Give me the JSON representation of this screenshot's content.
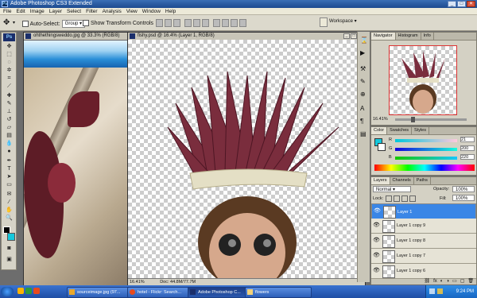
{
  "app": {
    "title": "Adobe Photoshop CS3 Extended"
  },
  "menu": [
    "File",
    "Edit",
    "Image",
    "Layer",
    "Select",
    "Filter",
    "Analysis",
    "View",
    "Window",
    "Help"
  ],
  "options": {
    "auto_select_label": "Auto-Select:",
    "auto_select_value": "Group",
    "show_transform_label": "Show Transform Controls",
    "workspace_label": "Workspace"
  },
  "docs": {
    "left_title": "ohthethingsweddo.jpg @ 33.3% (RGB/8)",
    "main_title": "fishy.psd @ 16.4% (Layer 1, RGB/8)",
    "main_zoom": "16.41%",
    "main_docsize": "Doc: 44.8M/77.7M"
  },
  "navigator": {
    "tabs": [
      "Navigator",
      "Histogram",
      "Info"
    ],
    "zoom": "16.41%"
  },
  "color": {
    "tabs": [
      "Color",
      "Swatches",
      "Styles"
    ],
    "r_label": "R",
    "r": "21",
    "g_label": "G",
    "g": "200",
    "b_label": "B",
    "b": "220",
    "fg": "#15c8dc"
  },
  "layers": {
    "tabs": [
      "Layers",
      "Channels",
      "Paths"
    ],
    "blend": "Normal",
    "opacity_label": "Opacity:",
    "opacity": "100%",
    "lock_label": "Lock:",
    "fill_label": "Fill:",
    "fill": "100%",
    "items": [
      "Layer 1",
      "Layer 1 copy 9",
      "Layer 1 copy 8",
      "Layer 1 copy 7",
      "Layer 1 copy 6"
    ]
  },
  "taskbar": {
    "start_label": "",
    "tasks": [
      "sourceimage.jpg (97...",
      "hotel - Flickr: Search...",
      "Adobe Photoshop C...",
      "flowers"
    ],
    "clock": "9:24 PM"
  }
}
